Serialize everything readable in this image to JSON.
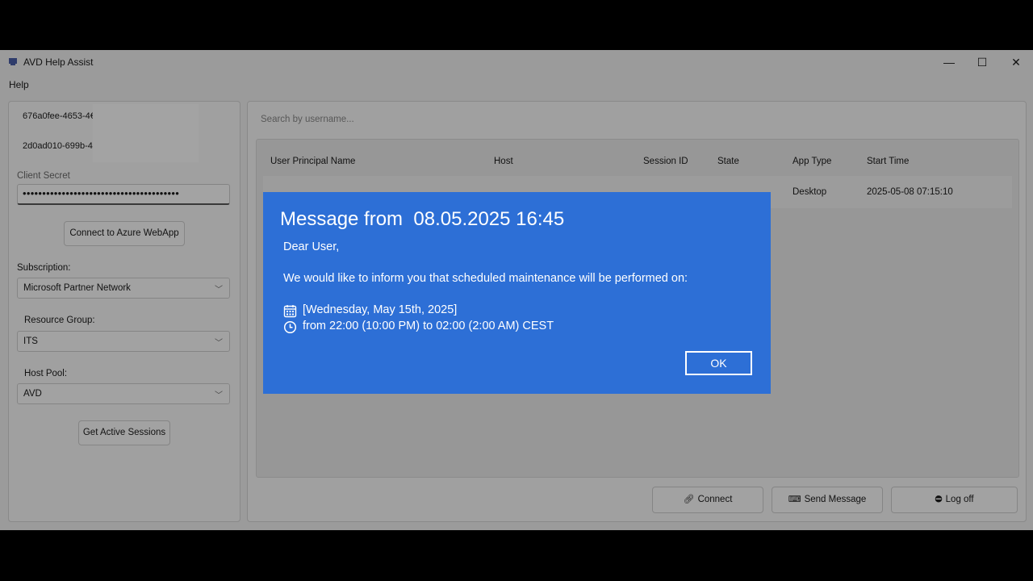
{
  "window": {
    "title": "AVD Help Assist",
    "controls": {
      "minimize": "—",
      "maximize": "☐",
      "close": "✕"
    }
  },
  "menu": {
    "help": "Help"
  },
  "left": {
    "id1": "676a0fee-4653-4€",
    "id2": "2d0ad010-699b-4",
    "client_secret_label": "Client Secret",
    "client_secret_value": "••••••••••••••••••••••••••••••••••••••••",
    "connect_button": "Connect to Azure WebApp",
    "subscription_label": "Subscription:",
    "subscription_value": "Microsoft Partner Network",
    "resource_group_label": "Resource Group:",
    "resource_group_value": "ITS",
    "host_pool_label": "Host Pool:",
    "host_pool_value": "AVD",
    "get_sessions_button": "Get Active Sessions"
  },
  "right": {
    "search_placeholder": "Search by username...",
    "columns": [
      "User Principal Name",
      "Host",
      "Session ID",
      "State",
      "App Type",
      "Start Time"
    ],
    "rows": [
      {
        "upn": "",
        "host": "",
        "session_id": "",
        "state": "",
        "app_type": "Desktop",
        "start_time": "2025-05-08 07:15:10"
      }
    ],
    "actions": {
      "connect": "Connect",
      "send_message": "Send Message",
      "log_off": "Log off"
    }
  },
  "dialog": {
    "title": "Message from  08.05.2025 16:45",
    "greeting": "Dear User,",
    "body": "We would like to inform you that scheduled maintenance will be performed on:",
    "date_line": "[Wednesday, May 15th, 2025]",
    "time_line": "from 22:00 (10:00 PM) to 02:00 (2:00 AM) CEST",
    "ok_label": "OK"
  },
  "colors": {
    "dialog_bg": "#2d6fd6",
    "window_bg": "#f3f3f3"
  }
}
